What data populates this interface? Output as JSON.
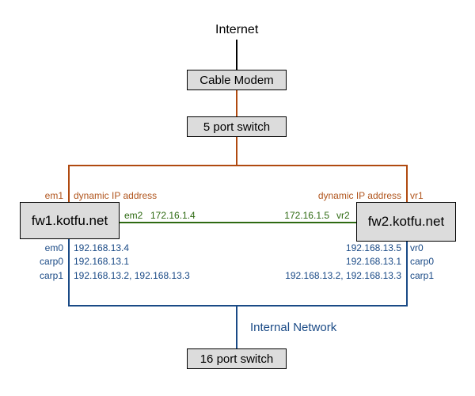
{
  "diagram": {
    "internet_label": "Internet",
    "nodes": {
      "cable_modem": "Cable Modem",
      "switch5": "5 port switch",
      "fw1": "fw1.kotfu.net",
      "fw2": "fw2.kotfu.net",
      "switch16": "16 port switch"
    },
    "fw1": {
      "external_if": "em1",
      "external_addr": "dynamic IP address",
      "sync_if": "em2",
      "sync_addr": "172.16.1.4",
      "internal": [
        {
          "if": "em0",
          "addr": "192.168.13.4"
        },
        {
          "if": "carp0",
          "addr": "192.168.13.1"
        },
        {
          "if": "carp1",
          "addr": "192.168.13.2, 192.168.13.3"
        }
      ]
    },
    "fw2": {
      "external_if": "vr1",
      "external_addr": "dynamic IP address",
      "sync_if": "vr2",
      "sync_addr": "172.16.1.5",
      "internal": [
        {
          "if": "vr0",
          "addr": "192.168.13.5"
        },
        {
          "if": "carp0",
          "addr": "192.168.13.1"
        },
        {
          "if": "carp1",
          "addr": "192.168.13.2, 192.168.13.3"
        }
      ]
    },
    "internal_network_label": "Internal Network",
    "colors": {
      "internet_link": "#000000",
      "external_link": "#b04a10",
      "sync_link": "#2e6a12",
      "internal_link": "#1a4a86",
      "node_fill": "#dcdcdc"
    }
  }
}
